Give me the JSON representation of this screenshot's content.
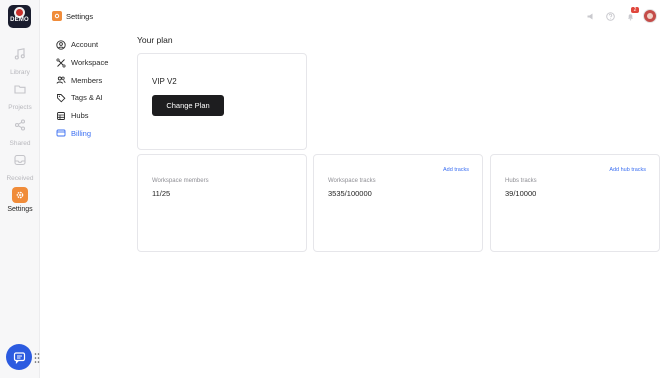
{
  "rail": {
    "logo_text": "DEMO",
    "items": [
      {
        "label": "Library",
        "icon": "music-note-icon"
      },
      {
        "label": "Projects",
        "icon": "folder-icon"
      },
      {
        "label": "Shared",
        "icon": "share-icon"
      },
      {
        "label": "Received",
        "icon": "inbox-icon"
      },
      {
        "label": "Settings",
        "icon": "gear-icon"
      }
    ]
  },
  "header": {
    "title": "Settings",
    "notification_count": "2"
  },
  "menu": {
    "items": [
      {
        "label": "Account",
        "icon": "user-icon"
      },
      {
        "label": "Workspace",
        "icon": "workspace-icon"
      },
      {
        "label": "Members",
        "icon": "members-icon"
      },
      {
        "label": "Tags & AI",
        "icon": "tag-icon"
      },
      {
        "label": "Hubs",
        "icon": "hub-icon"
      },
      {
        "label": "Billing",
        "icon": "credit-card-icon"
      }
    ],
    "active": "Billing"
  },
  "plan": {
    "section_title": "Your plan",
    "name": "VIP V2",
    "change_button": "Change Plan"
  },
  "stats": [
    {
      "label": "Workspace members",
      "value": "11/25",
      "link": ""
    },
    {
      "label": "Workspace tracks",
      "value": "3535/100000",
      "link": "Add tracks"
    },
    {
      "label": "Hubs tracks",
      "value": "39/10000",
      "link": "Add hub tracks"
    }
  ],
  "colors": {
    "accent": "#3b6ff2",
    "brand_orange": "#f08c3a",
    "button_dark": "#1d1d1f"
  }
}
